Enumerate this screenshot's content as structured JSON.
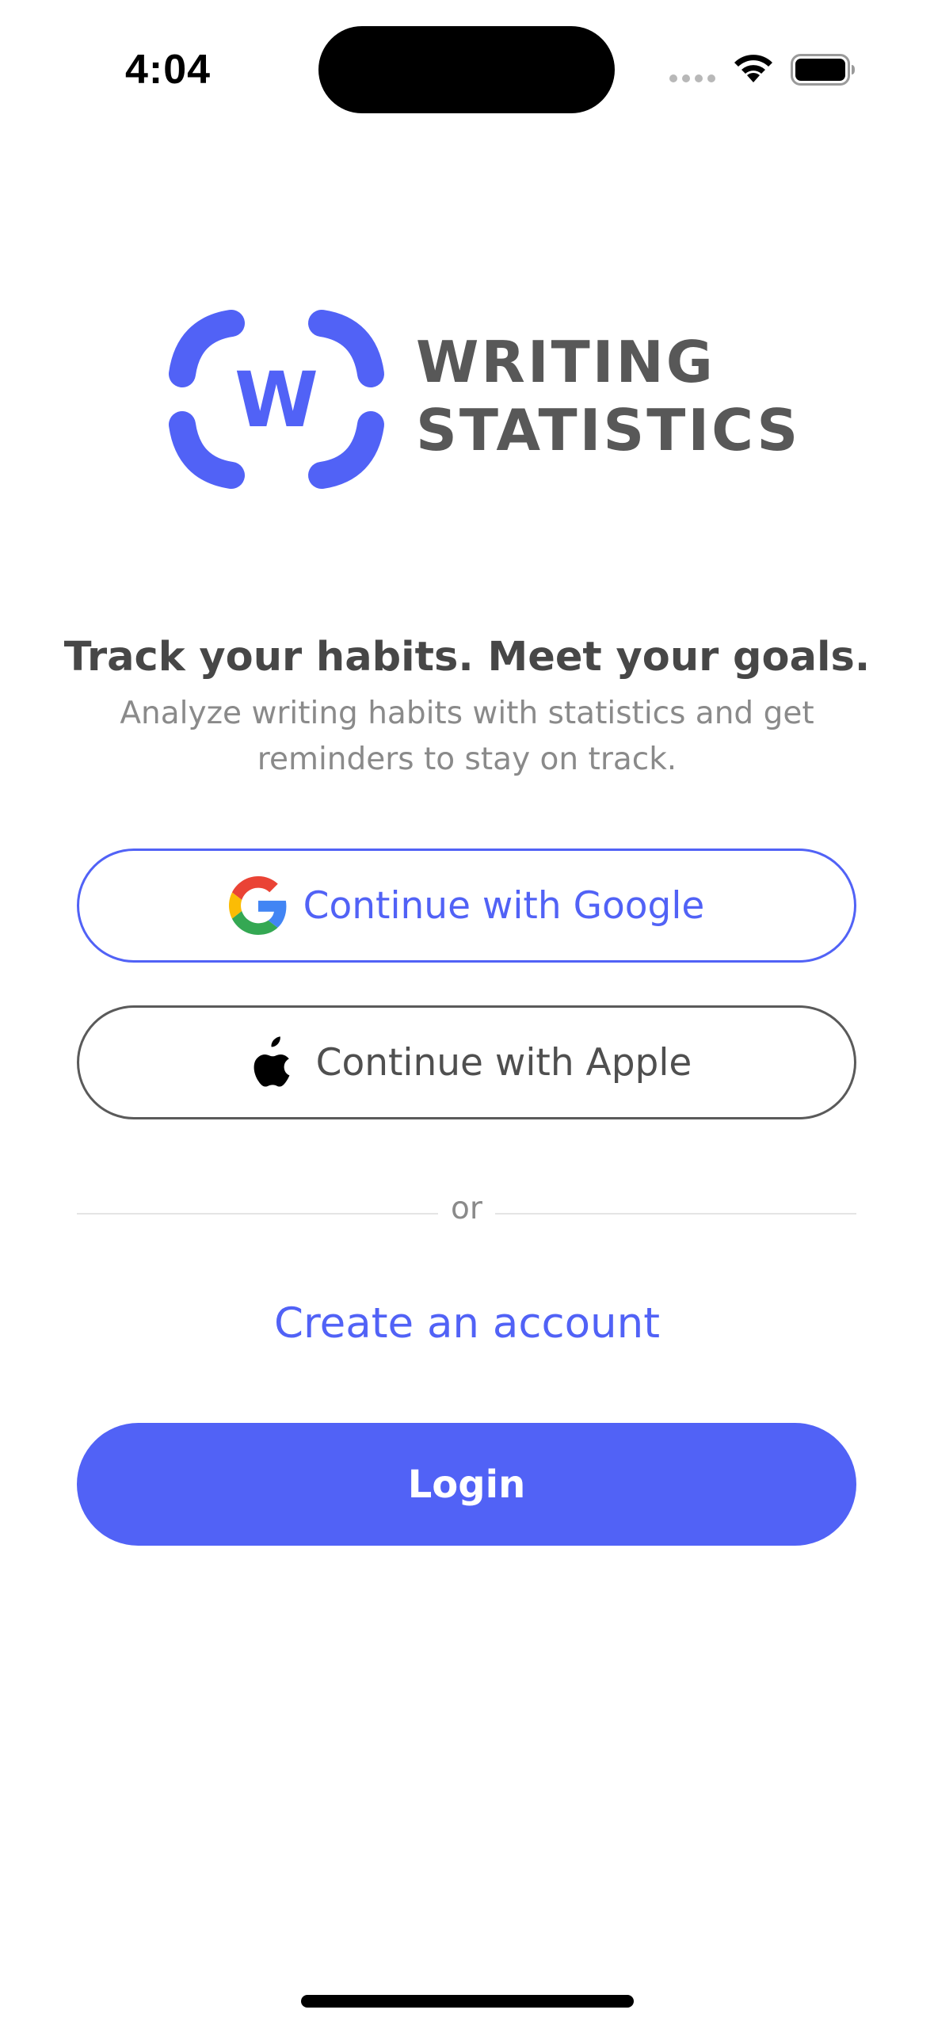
{
  "status_bar": {
    "time": "4:04"
  },
  "brand": {
    "logo_letter": "W",
    "name_line1": "WRITING",
    "name_line2": "STATISTICS",
    "accent_color": "#5162f6"
  },
  "hero": {
    "headline": "Track your habits. Meet your goals.",
    "subline": "Analyze writing habits with statistics and get reminders to stay on track."
  },
  "auth": {
    "google_label": "Continue with Google",
    "google_icon": "google-logo-icon",
    "apple_label": "Continue with Apple",
    "apple_icon": "apple-logo-icon",
    "divider_text": "or",
    "create_account_label": "Create an account",
    "login_label": "Login"
  }
}
